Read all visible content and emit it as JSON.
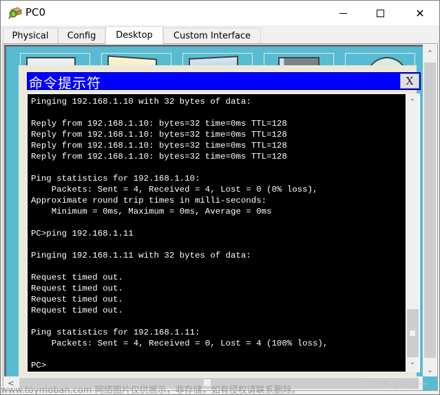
{
  "window": {
    "title": "PC0",
    "icon": "packet-tracer-pc-icon",
    "controls": {
      "minimize": "minimize-icon",
      "maximize": "maximize-icon",
      "close": "close-icon",
      "close_glyph": "✕"
    }
  },
  "tabs": [
    {
      "label": "Physical",
      "active": false
    },
    {
      "label": "Config",
      "active": false
    },
    {
      "label": "Desktop",
      "active": true
    },
    {
      "label": "Custom Interface",
      "active": false
    }
  ],
  "command_prompt": {
    "title": "命令提示符",
    "close_label": "X",
    "lines": [
      "Pinging 192.168.1.10 with 32 bytes of data:",
      "",
      "Reply from 192.168.1.10: bytes=32 time=0ms TTL=128",
      "Reply from 192.168.1.10: bytes=32 time=0ms TTL=128",
      "Reply from 192.168.1.10: bytes=32 time=0ms TTL=128",
      "Reply from 192.168.1.10: bytes=32 time=0ms TTL=128",
      "",
      "Ping statistics for 192.168.1.10:",
      "    Packets: Sent = 4, Received = 4, Lost = 0 (0% loss),",
      "Approximate round trip times in milli-seconds:",
      "    Minimum = 0ms, Maximum = 0ms, Average = 0ms",
      "",
      "PC>ping 192.168.1.11",
      "",
      "Pinging 192.168.1.11 with 32 bytes of data:",
      "",
      "Request timed out.",
      "Request timed out.",
      "Request timed out.",
      "Request timed out.",
      "",
      "Ping statistics for 192.168.1.11:",
      "    Packets: Sent = 4, Received = 0, Lost = 4 (100% loss),",
      "",
      "PC>"
    ]
  },
  "scroll": {
    "up_glyph": "⌃",
    "down_glyph": "⌄",
    "left_glyph": "<"
  },
  "watermark": {
    "left": "www.toymoban.com 网络图片仅供展示，非存储，如有侵权请联系删除。",
    "right": "CSDN @尚泽一"
  }
}
